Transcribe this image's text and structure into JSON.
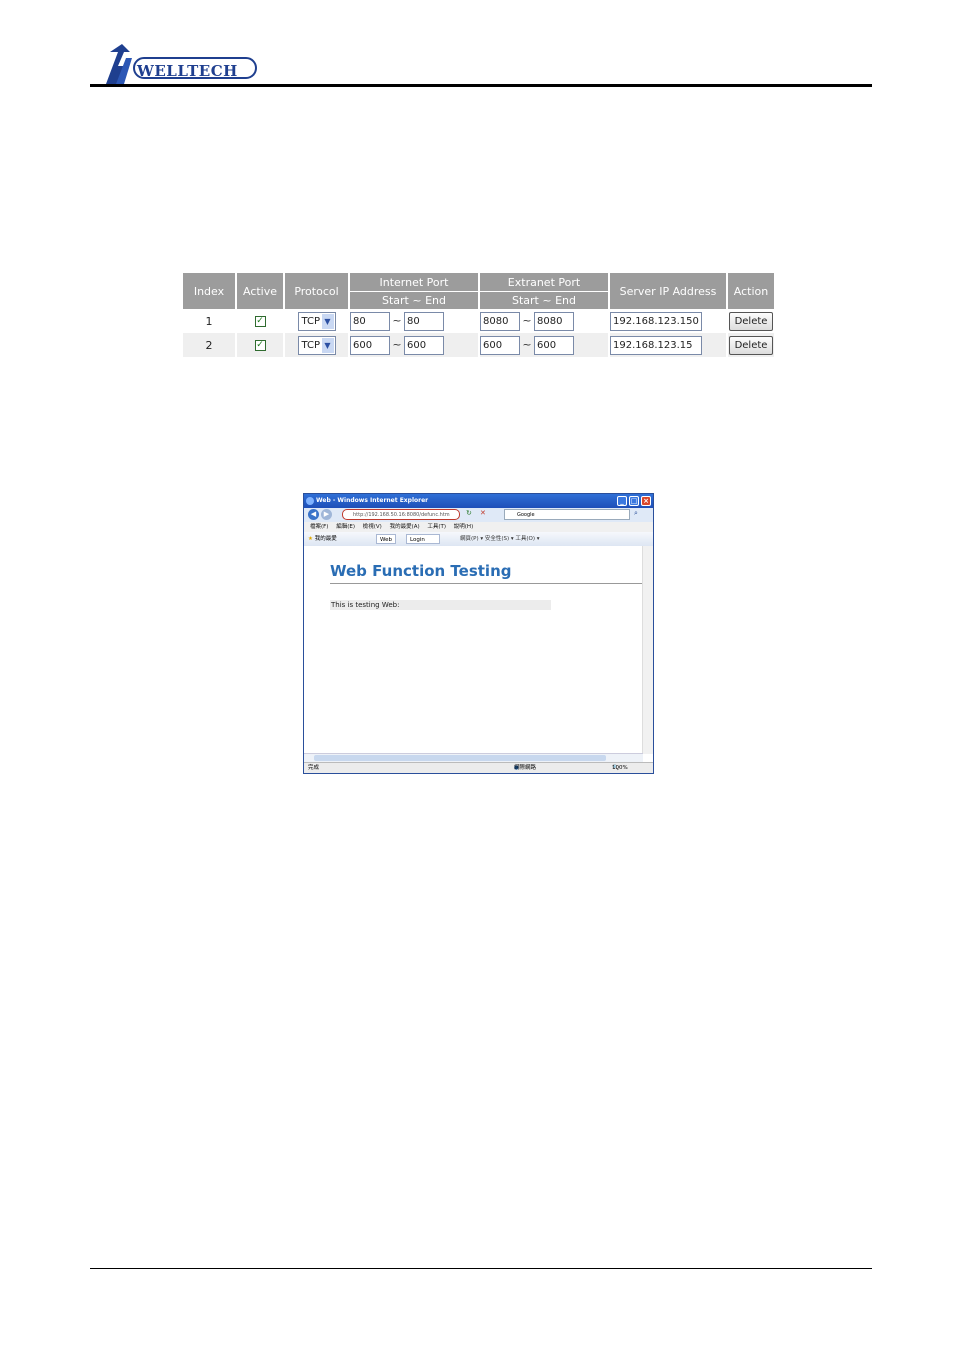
{
  "header": {
    "logo_text": "WELLTECH"
  },
  "table": {
    "headers": {
      "index": "Index",
      "active": "Active",
      "protocol": "Protocol",
      "internet_port": "Internet Port",
      "extranet_port": "Extranet Port",
      "server_ip": "Server IP Address",
      "action": "Action",
      "range_internet": "Start ~ End",
      "range_extranet": "Start ~ End"
    },
    "tilde": "~",
    "rows": [
      {
        "index": "1",
        "active": true,
        "check": "✓",
        "protocol": "TCP",
        "int_start": "80",
        "int_end": "80",
        "ext_start": "8080",
        "ext_end": "8080",
        "ip": "192.168.123.150",
        "action": "Delete"
      },
      {
        "index": "2",
        "active": true,
        "check": "✓",
        "protocol": "TCP",
        "int_start": "600",
        "int_end": "600",
        "ext_start": "600",
        "ext_end": "600",
        "ip": "192.168.123.15",
        "action": "Delete"
      }
    ]
  },
  "browser": {
    "window_title": "Web - Windows Internet Explorer",
    "address": "http://192.168.50.16:8080/defunc.htm",
    "search_provider": "Google",
    "menu": [
      "檔案(F)",
      "編輯(E)",
      "檢視(V)",
      "我的最愛(A)",
      "工具(T)",
      "說明(H)"
    ],
    "favorites_label": "我的最愛",
    "tabs": [
      "Web",
      "Login"
    ],
    "toolbar_text": "網頁(P) ▾  安全性(S) ▾  工具(O) ▾",
    "page_heading": "Web Function Testing",
    "page_text": "This is testing Web:",
    "status_left": "完成",
    "status_zone": "網際網路",
    "status_zoom": "100%"
  },
  "icons": {
    "browser_back": "back-arrow-icon",
    "browser_forward": "forward-arrow-icon",
    "minimize": "minimize-icon",
    "maximize": "maximize-icon",
    "close": "close-icon"
  }
}
